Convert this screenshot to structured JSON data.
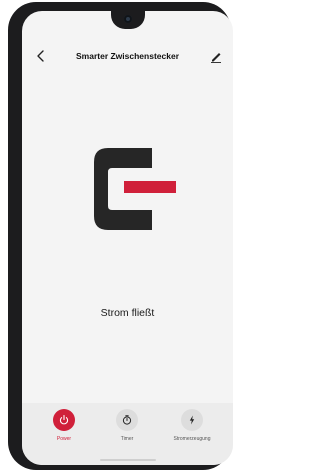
{
  "header": {
    "title": "Smarter Zwischenstecker",
    "back_icon": "chevron-left-icon",
    "edit_icon": "edit-pencil-icon"
  },
  "device": {
    "logo_icon": "brand-logo-icon",
    "status": "Strom fließt"
  },
  "actions": [
    {
      "label": "Power",
      "icon": "power-icon",
      "active": true
    },
    {
      "label": "Timer",
      "icon": "timer-icon",
      "active": false
    },
    {
      "label": "Stromerzeugung",
      "icon": "lightning-icon",
      "active": false
    }
  ],
  "colors": {
    "accent": "#d0203a",
    "logo_dark": "#262626",
    "background": "#f4f4f4",
    "bottom_bar": "#ececec"
  }
}
